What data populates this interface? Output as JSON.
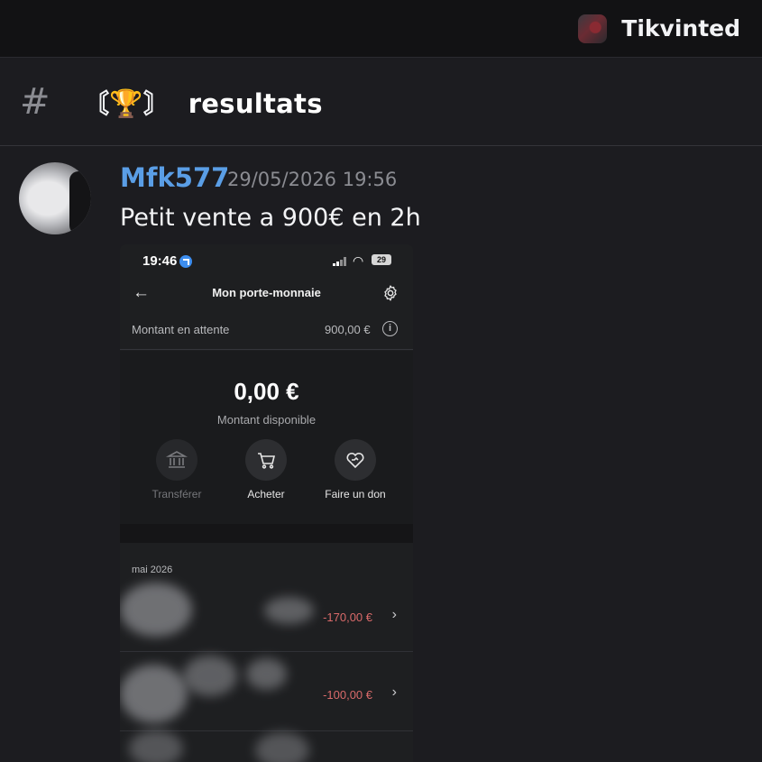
{
  "server": {
    "name": "Tikvinted",
    "icon": "server-avatar-icon"
  },
  "channel": {
    "icon": "hash-icon",
    "bracket_left": "〘",
    "emoji": "🏆",
    "bracket_right": "〙",
    "name": "resultats"
  },
  "message": {
    "username": "Mfk577",
    "timestamp": "29/05/2026 19:56",
    "text": "Petit vente a 900€ en 2h",
    "username_color": "#5a9ee6"
  },
  "attachment": {
    "status_bar": {
      "time": "19:46",
      "battery": "29"
    },
    "title": "Mon porte-monnaie",
    "pending": {
      "label": "Montant en attente",
      "value": "900,00 €"
    },
    "balance": {
      "amount": "0,00 €",
      "label": "Montant disponible"
    },
    "actions": [
      {
        "label": "Transférer",
        "icon": "bank-icon",
        "enabled": false
      },
      {
        "label": "Acheter",
        "icon": "cart-icon",
        "enabled": true
      },
      {
        "label": "Faire un don",
        "icon": "heart-donate-icon",
        "enabled": true
      }
    ],
    "month": "mai 2026",
    "transactions": [
      {
        "amount": "-170,00 €"
      },
      {
        "amount": "-100,00 €"
      }
    ],
    "negative_color": "#d96a6a"
  }
}
